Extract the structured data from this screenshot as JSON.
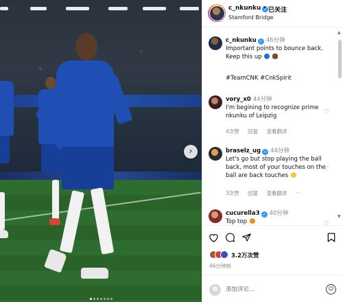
{
  "post": {
    "username": "c_nkunku",
    "verified_icon": "verified-badge-icon",
    "separator": "•",
    "follow_label": "已关注",
    "location": "Stamford Bridge"
  },
  "caption": {
    "username": "c_nkunku",
    "time": "46分钟",
    "text": "Important points to bounce back. Keep this up",
    "hashtags": "#TeamCNK #CnkSpirit"
  },
  "comments": [
    {
      "username": "vory_x0",
      "time": "44分钟",
      "text": "I'm begining to recognize prime nkunku of Leipzig",
      "likes": "4次赞",
      "reply_label": "回复",
      "translate_label": "查看翻译"
    },
    {
      "username": "braselz_ug",
      "time": "44分钟",
      "text": "Let's go but stop playing the ball back, most of your touches on the ball are back touches",
      "likes": "3次赞",
      "reply_label": "回复",
      "translate_label": "查看翻译",
      "more_label": "···"
    },
    {
      "username": "cucurella3",
      "time": "40分钟",
      "text": "Top top"
    }
  ],
  "actions": {
    "like_icon": "heart-icon",
    "comment_icon": "comment-bubble-icon",
    "share_icon": "paper-plane-icon",
    "save_icon": "bookmark-icon",
    "likes_text": "3.2万次赞",
    "posted_time": "46分钟前"
  },
  "add_comment": {
    "placeholder": "添加评论...",
    "emoji_icon": "smiley-icon"
  },
  "colors": {
    "verified": "#3897f0",
    "hashtag": "#00376b",
    "chelsea_blue": "#1f4fb5"
  }
}
